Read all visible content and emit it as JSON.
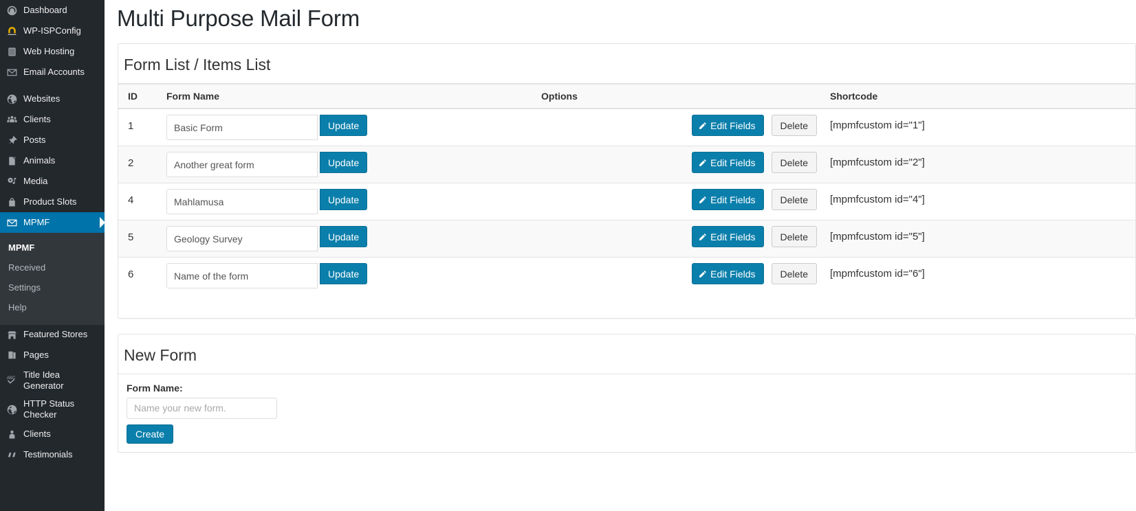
{
  "sidebar": {
    "items": [
      {
        "label": "Dashboard",
        "icon": "dashboard-icon",
        "gap": false
      },
      {
        "label": "WP-ISPConfig",
        "icon": "horseshoe-icon",
        "gap": false
      },
      {
        "label": "Web Hosting",
        "icon": "server-icon",
        "gap": false
      },
      {
        "label": "Email Accounts",
        "icon": "envelope-icon",
        "gap": false
      },
      {
        "label": "Websites",
        "icon": "globe-icon",
        "gap": true
      },
      {
        "label": "Clients",
        "icon": "group-icon",
        "gap": false
      },
      {
        "label": "Posts",
        "icon": "pushpin-icon",
        "gap": false
      },
      {
        "label": "Animals",
        "icon": "page-add-icon",
        "gap": false
      },
      {
        "label": "Media",
        "icon": "media-icon",
        "gap": false
      },
      {
        "label": "Product Slots",
        "icon": "bag-icon",
        "gap": false
      },
      {
        "label": "MPMF",
        "icon": "envelope-icon",
        "gap": false,
        "current": true
      }
    ],
    "submenu": [
      {
        "label": "MPMF",
        "current": true
      },
      {
        "label": "Received",
        "current": false
      },
      {
        "label": "Settings",
        "current": false
      },
      {
        "label": "Help",
        "current": false
      }
    ],
    "items_after": [
      {
        "label": "Featured Stores",
        "icon": "store-icon"
      },
      {
        "label": "Pages",
        "icon": "pages-icon"
      },
      {
        "label": "Title Idea Generator",
        "icon": "abc-check-icon"
      },
      {
        "label": "HTTP Status Checker",
        "icon": "globe-icon"
      },
      {
        "label": "Clients",
        "icon": "person-icon"
      },
      {
        "label": "Testimonials",
        "icon": "quote-icon"
      }
    ],
    "accent_color": "#0073aa",
    "background_color": "#23282d",
    "submenu_background_color": "#32373c"
  },
  "page": {
    "title": "Multi Purpose Mail Form"
  },
  "form_list_panel": {
    "heading": "Form List / Items List",
    "columns": [
      "ID",
      "Form Name",
      "Options",
      "Shortcode"
    ],
    "rows": [
      {
        "id": "1",
        "name": "Basic Form",
        "update_label": "Update",
        "edit_label": "Edit Fields",
        "delete_label": "Delete",
        "shortcode": "[mpmfcustom id=\"1\"]"
      },
      {
        "id": "2",
        "name": "Another great form",
        "update_label": "Update",
        "edit_label": "Edit Fields",
        "delete_label": "Delete",
        "shortcode": "[mpmfcustom id=\"2\"]"
      },
      {
        "id": "4",
        "name": "Mahlamusa",
        "update_label": "Update",
        "edit_label": "Edit Fields",
        "delete_label": "Delete",
        "shortcode": "[mpmfcustom id=\"4\"]"
      },
      {
        "id": "5",
        "name": "Geology Survey",
        "update_label": "Update",
        "edit_label": "Edit Fields",
        "delete_label": "Delete",
        "shortcode": "[mpmfcustom id=\"5\"]"
      },
      {
        "id": "6",
        "name": "Name of the form",
        "update_label": "Update",
        "edit_label": "Edit Fields",
        "delete_label": "Delete",
        "shortcode": "[mpmfcustom id=\"6\"]"
      }
    ]
  },
  "new_form_panel": {
    "heading": "New Form",
    "field_label": "Form Name:",
    "field_value": "",
    "field_placeholder": "Name your new form.",
    "create_label": "Create"
  },
  "colors": {
    "primary_button": "#0b7fab",
    "accent": "#0073aa",
    "stripe": "#f9f9f9"
  }
}
